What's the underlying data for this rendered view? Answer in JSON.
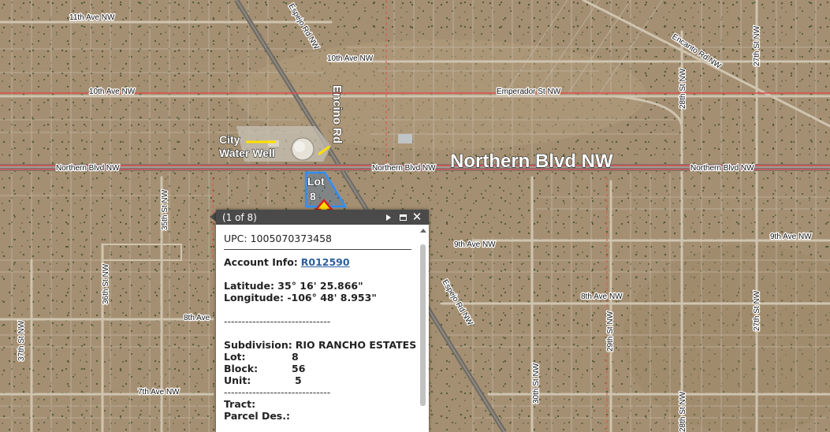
{
  "map": {
    "streets": {
      "ave_11": "11th Ave NW",
      "ave_10_top": "10th Ave NW",
      "ave_10_left": "10th Ave NW",
      "emperador": "Emperador St NW",
      "encanto": "Encanto Rd NW",
      "northern_left": "Northern Blvd NW",
      "northern_mid": "Northern Blvd NW",
      "northern_right": "Northern Blvd NW",
      "northern_big": "Northern Blvd NW",
      "espejo_top": "Espejo Rd NW",
      "espejo_bottom": "Espejo Rd NW",
      "encino": "Encino Rd",
      "ave_9_mid": "9th Ave NW",
      "ave_9_right": "9th Ave NW",
      "ave_8_mid": "8th Ave NW",
      "ave_8_left": "8th Ave",
      "ave_7": "7th Ave NW",
      "st_35": "35th St NW",
      "st_36": "36th St NW",
      "st_37": "37th St NW",
      "st_30": "30th St NW",
      "st_29": "29th St NW",
      "st_28_top": "28th St NW",
      "st_28_bottom": "28th St NW",
      "st_27_top": "27th St NW",
      "st_27_bottom": "27th St NW"
    },
    "annotations": {
      "city_water_well_line1": "City",
      "city_water_well_line2": "Water Well",
      "lot_line1": "Lot",
      "lot_line2": "8"
    },
    "colors": {
      "ground": "#a58f72",
      "boundary_red": "#e05050",
      "parcel_line": "#c8c0b0",
      "parcel_highlight": "#2f8fff",
      "arrow_red": "#d82020",
      "arrow_yellow": "#ffe000"
    }
  },
  "popup": {
    "count": "(1 of 8)",
    "upc": "UPC: 1005070373458",
    "account_label": "Account Info:",
    "account_link": "R012590",
    "latitude": "Latitude: 35° 16' 25.866\"",
    "longitude": "Longitude: -106° 48' 8.953\"",
    "separator": "------------------------------",
    "subdivision_label": "Subdivision:",
    "subdivision_value": "RIO RANCHO ESTATES",
    "lot_label": "Lot:",
    "lot_value": "8",
    "block_label": "Block:",
    "block_value": "56",
    "unit_label": "Unit:",
    "unit_value": "5",
    "tract_label": "Tract:",
    "parcel_label": "Parcel Des.:"
  }
}
